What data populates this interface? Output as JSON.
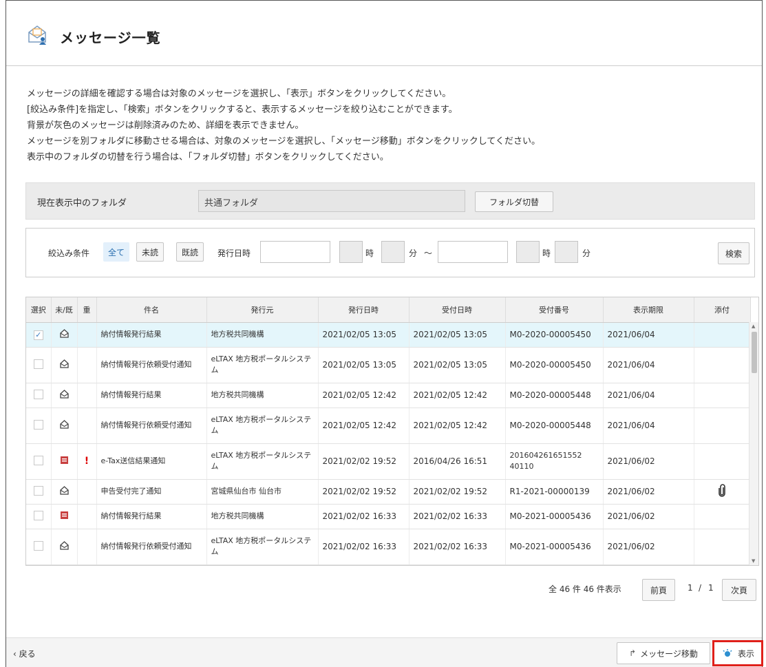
{
  "header": {
    "title": "メッセージ一覧",
    "icon": "envelope-person-icon"
  },
  "description": [
    "メッセージの詳細を確認する場合は対象のメッセージを選択し、「表示」ボタンをクリックしてください。",
    "[絞込み条件]を指定し、「検索」ボタンをクリックすると、表示するメッセージを絞り込むことができます。",
    "背景が灰色のメッセージは削除済みのため、詳細を表示できません。",
    "メッセージを別フォルダに移動させる場合は、対象のメッセージを選択し、「メッセージ移動」ボタンをクリックしてください。",
    "表示中のフォルダの切替を行う場合は、「フォルダ切替」ボタンをクリックしてください。"
  ],
  "folder": {
    "label": "現在表示中のフォルダ",
    "value": "共通フォルダ",
    "switch_label": "フォルダ切替"
  },
  "filter": {
    "label": "絞込み条件",
    "options": [
      "全て",
      "未読",
      "既読"
    ],
    "selected": "全て",
    "date_label": "発行日時",
    "hour_unit": "時",
    "minute_unit": "分",
    "range_sep": "～",
    "search_label": "検索"
  },
  "table": {
    "columns": [
      "選択",
      "未/既",
      "重",
      "件名",
      "発行元",
      "発行日時",
      "受付日時",
      "受付番号",
      "表示期限",
      "添付"
    ],
    "rows": [
      {
        "selected": true,
        "status": "read",
        "important": "",
        "subject": "納付情報発行結果",
        "issuer": "地方税共同機構",
        "issued": "2021/02/05 13:05",
        "received": "2021/02/05 13:05",
        "number": "M0-2020-00005450",
        "expiry": "2021/06/04",
        "attachment": false
      },
      {
        "selected": false,
        "status": "read",
        "important": "",
        "subject": "納付情報発行依頼受付通知",
        "issuer": "eLTAX 地方税ポータルシステム",
        "issued": "2021/02/05 13:05",
        "received": "2021/02/05 13:05",
        "number": "M0-2020-00005450",
        "expiry": "2021/06/04",
        "attachment": false
      },
      {
        "selected": false,
        "status": "read",
        "important": "",
        "subject": "納付情報発行結果",
        "issuer": "地方税共同機構",
        "issued": "2021/02/05 12:42",
        "received": "2021/02/05 12:42",
        "number": "M0-2020-00005448",
        "expiry": "2021/06/04",
        "attachment": false
      },
      {
        "selected": false,
        "status": "read",
        "important": "",
        "subject": "納付情報発行依頼受付通知",
        "issuer": "eLTAX 地方税ポータルシステム",
        "issued": "2021/02/05 12:42",
        "received": "2021/02/05 12:42",
        "number": "M0-2020-00005448",
        "expiry": "2021/06/04",
        "attachment": false
      },
      {
        "selected": false,
        "status": "unread",
        "important": "!",
        "subject": "e-Tax送信結果通知",
        "issuer": "eLTAX 地方税ポータルシステム",
        "issued": "2021/02/02 19:52",
        "received": "2016/04/26 16:51",
        "number": "20160426165155240110",
        "number_lines": [
          "201604261651552",
          "40110"
        ],
        "expiry": "2021/06/02",
        "attachment": false
      },
      {
        "selected": false,
        "status": "read",
        "important": "",
        "subject": "申告受付完了通知",
        "issuer": "宮城県仙台市 仙台市",
        "issued": "2021/02/02 19:52",
        "received": "2021/02/02 19:52",
        "number": "R1-2021-00000139",
        "expiry": "2021/06/02",
        "attachment": true
      },
      {
        "selected": false,
        "status": "unread",
        "important": "",
        "subject": "納付情報発行結果",
        "issuer": "地方税共同機構",
        "issued": "2021/02/02 16:33",
        "received": "2021/02/02 16:33",
        "number": "M0-2021-00005436",
        "expiry": "2021/06/02",
        "attachment": false
      },
      {
        "selected": false,
        "status": "read",
        "important": "",
        "subject": "納付情報発行依頼受付通知",
        "issuer": "eLTAX 地方税ポータルシステム",
        "issued": "2021/02/02 16:33",
        "received": "2021/02/02 16:33",
        "number": "M0-2021-00005436",
        "expiry": "2021/06/02",
        "attachment": false
      }
    ]
  },
  "pagination": {
    "summary": "全 46 件  46 件表示",
    "prev_label": "前頁",
    "page": "1",
    "sep": "/",
    "total": "1",
    "next_label": "次頁"
  },
  "footer": {
    "back_label": "戻る",
    "move_label": "メッセージ移動",
    "show_label": "表示"
  },
  "colors": {
    "highlight": "#e0201a",
    "selected_row": "#e4f6fb",
    "unread_icon": "#c84040"
  }
}
